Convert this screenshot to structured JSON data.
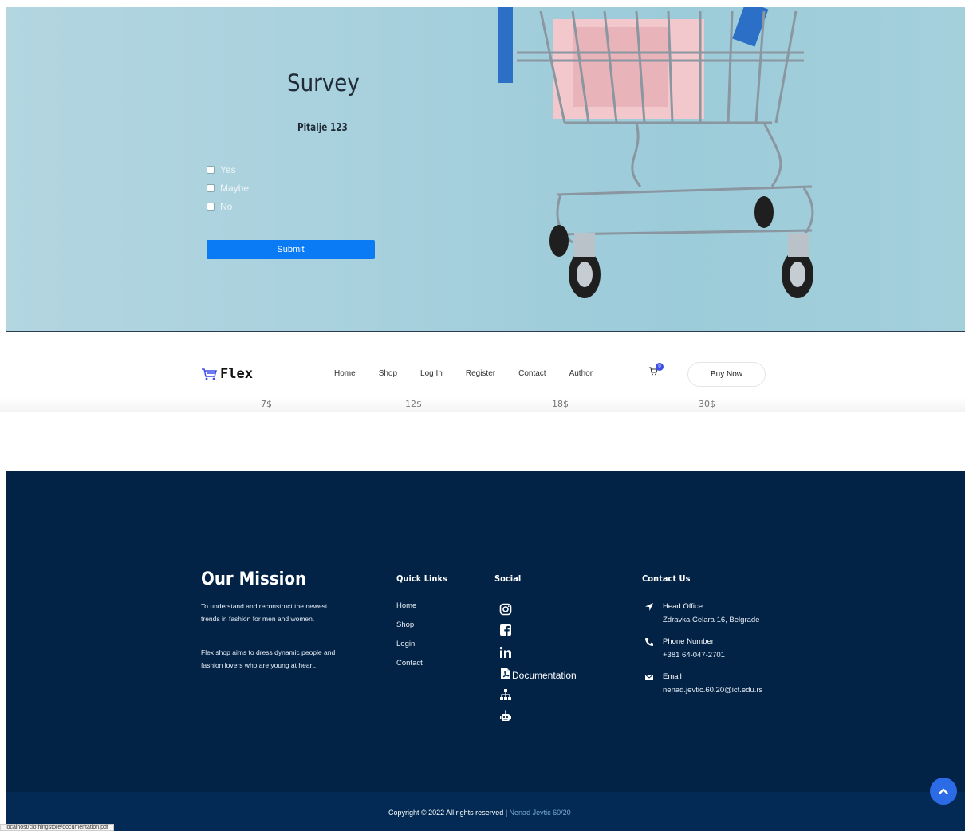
{
  "survey": {
    "title": "Survey",
    "question": "Pitalje 123",
    "options": [
      "Yes",
      "Maybe",
      "No"
    ],
    "submit_label": "Submit"
  },
  "header": {
    "logo_text": "Flex",
    "nav": [
      "Home",
      "Shop",
      "Log In",
      "Register",
      "Contact",
      "Author"
    ],
    "cart_count": "0",
    "buy_now_label": "Buy Now"
  },
  "prices": [
    "7$",
    "12$",
    "18$",
    "30$"
  ],
  "footer": {
    "mission": {
      "title": "Our Mission",
      "text1": "To understand and reconstruct the newest trends in fashion for men and women.",
      "text2": "Flex shop aims to dress dynamic people and fashion lovers who are young at heart."
    },
    "quick_links": {
      "title": "Quick Links",
      "items": [
        "Home",
        "Shop",
        "Login",
        "Contact"
      ]
    },
    "social": {
      "title": "Social",
      "icons": [
        "instagram-icon",
        "facebook-icon",
        "linkedin-icon",
        "pdf-icon",
        "sitemap-icon",
        "robot-icon"
      ],
      "documentation_label": "Documentation"
    },
    "contact": {
      "title": "Contact Us",
      "office_label": "Head Office",
      "office_value": "Zdravka Celara 16, Belgrade",
      "phone_label": "Phone Number",
      "phone_value": "+381 64-047-2701",
      "email_label": "Email",
      "email_value": "nenad.jevtic.60.20@ict.edu.rs"
    },
    "copyright": "Copyright © 2022 All rights reserved | ",
    "author": "Nenad Jevtic 60/20"
  },
  "status_url": "localhost/clothingstore/documentation.pdf",
  "colors": {
    "accent": "#0a7bf5",
    "footer_bg": "#022346",
    "scroll_button": "#2c6be6"
  }
}
